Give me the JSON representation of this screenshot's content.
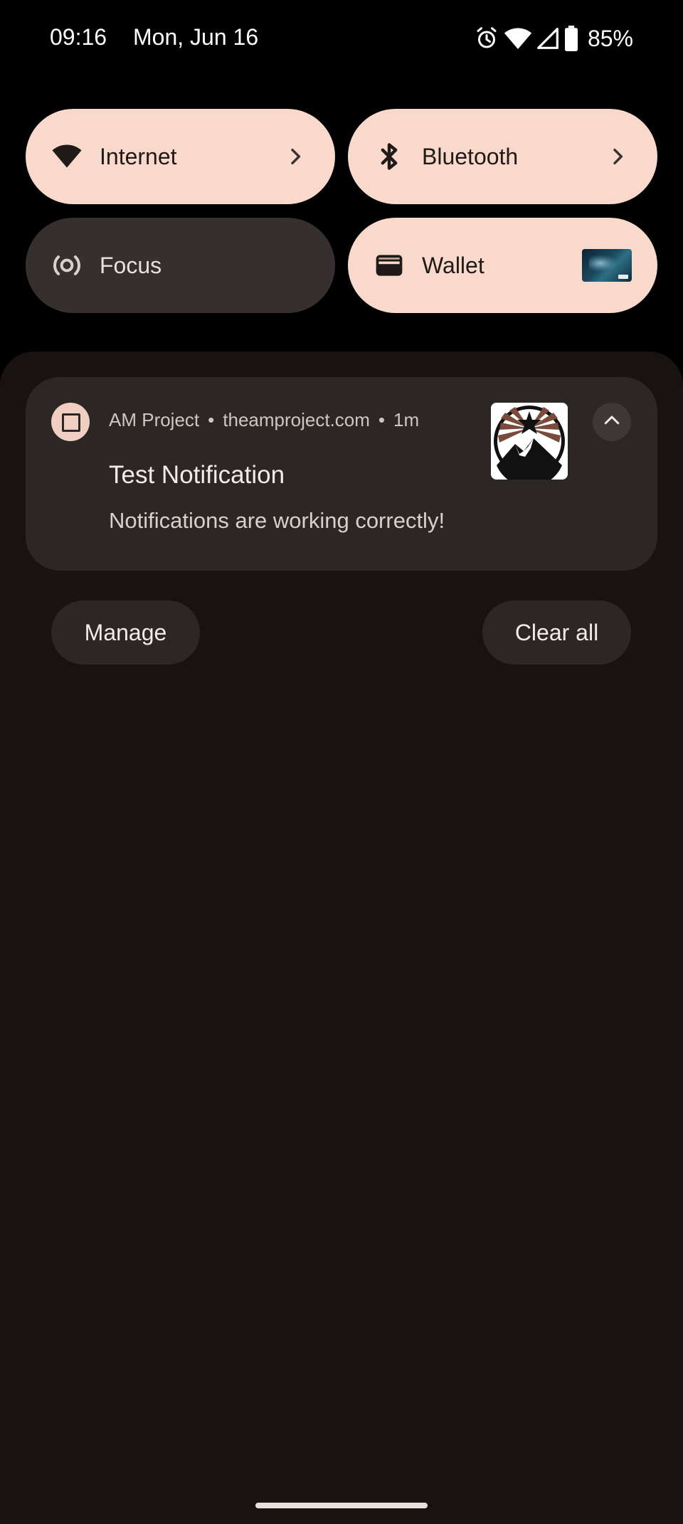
{
  "status_bar": {
    "time": "09:16",
    "date": "Mon, Jun 16",
    "battery_percent": "85%",
    "icons": [
      "alarm-icon",
      "wifi-icon",
      "cell-signal-icon",
      "battery-icon"
    ]
  },
  "quick_settings": {
    "tiles": [
      {
        "label": "Internet",
        "icon": "wifi-icon",
        "state": "on",
        "has_chevron": true
      },
      {
        "label": "Bluetooth",
        "icon": "bluetooth-icon",
        "state": "on",
        "has_chevron": true
      },
      {
        "label": "Focus",
        "icon": "focus-icon",
        "state": "off",
        "has_chevron": false
      },
      {
        "label": "Wallet",
        "icon": "wallet-icon",
        "state": "on",
        "has_chevron": false
      }
    ]
  },
  "notification": {
    "app_name": "AM Project",
    "site": "theamproject.com",
    "time_ago": "1m",
    "title": "Test Notification",
    "text": "Notifications are working correctly!",
    "large_icon": "am-project-logo-icon"
  },
  "actions": {
    "manage_label": "Manage",
    "clear_all_label": "Clear all"
  },
  "colors": {
    "tile_on": "#f9d9cc",
    "tile_off": "#35302e",
    "shade_bg": "#181311",
    "card_bg": "#2c2725"
  }
}
